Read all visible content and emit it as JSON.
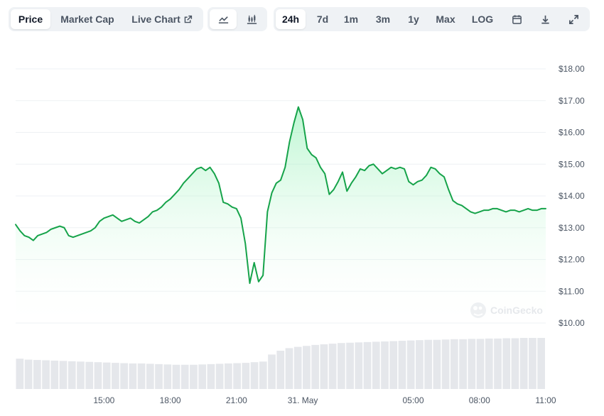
{
  "toolbar": {
    "view_tabs": [
      {
        "label": "Price",
        "active": true
      },
      {
        "label": "Market Cap",
        "active": false
      },
      {
        "label": "Live Chart",
        "active": false,
        "icon": "external-link-icon"
      }
    ],
    "chart_style_buttons": [
      {
        "icon": "line-chart-icon",
        "active": true
      },
      {
        "icon": "candlestick-chart-icon",
        "active": false
      }
    ],
    "range_tabs": [
      {
        "label": "24h",
        "active": true
      },
      {
        "label": "7d",
        "active": false
      },
      {
        "label": "1m",
        "active": false
      },
      {
        "label": "3m",
        "active": false
      },
      {
        "label": "1y",
        "active": false
      },
      {
        "label": "Max",
        "active": false
      },
      {
        "label": "LOG",
        "active": false
      }
    ],
    "utility_buttons": [
      {
        "icon": "calendar-icon"
      },
      {
        "icon": "download-icon"
      },
      {
        "icon": "expand-icon"
      }
    ]
  },
  "watermark": {
    "text": "CoinGecko",
    "icon": "coingecko-logo-icon"
  },
  "colors": {
    "line": "#16a34a",
    "area_top": "#86efac",
    "area_bottom": "#ffffff",
    "volume": "#e5e7eb",
    "grid": "#eef1f4",
    "axis_text": "#4b5563",
    "active_bg": "#ffffff",
    "toolbar_bg": "#eff2f5"
  },
  "chart_data": {
    "type": "area",
    "x_tick_labels": [
      "15:00",
      "18:00",
      "21:00",
      "31. May",
      "05:00",
      "08:00",
      "11:00"
    ],
    "y_tick_labels": [
      "$18.00",
      "$17.00",
      "$16.00",
      "$15.00",
      "$14.00",
      "$13.00",
      "$12.00",
      "$11.00",
      "$10.00"
    ],
    "y_ticks": [
      18,
      17,
      16,
      15,
      14,
      13,
      12,
      11,
      10
    ],
    "x_ticks_hours": [
      15,
      18,
      21,
      24,
      29,
      32,
      35
    ],
    "ylim": [
      10,
      18
    ],
    "xlim_hours": [
      11.0,
      35.0
    ],
    "grid": true,
    "legend": "none",
    "price_series": {
      "name": "",
      "x_hours": [
        11.0,
        11.2,
        11.4,
        11.6,
        11.8,
        12.0,
        12.2,
        12.4,
        12.6,
        12.8,
        13.0,
        13.2,
        13.4,
        13.6,
        13.8,
        14.0,
        14.2,
        14.4,
        14.6,
        14.8,
        15.0,
        15.2,
        15.4,
        15.6,
        15.8,
        16.0,
        16.2,
        16.4,
        16.6,
        16.8,
        17.0,
        17.2,
        17.4,
        17.6,
        17.8,
        18.0,
        18.2,
        18.4,
        18.6,
        18.8,
        19.0,
        19.2,
        19.4,
        19.6,
        19.8,
        20.0,
        20.2,
        20.4,
        20.6,
        20.8,
        21.0,
        21.2,
        21.4,
        21.6,
        21.8,
        22.0,
        22.2,
        22.4,
        22.6,
        22.8,
        23.0,
        23.2,
        23.4,
        23.6,
        23.8,
        24.0,
        24.2,
        24.4,
        24.6,
        24.8,
        25.0,
        25.2,
        25.4,
        25.6,
        25.8,
        26.0,
        26.2,
        26.4,
        26.6,
        26.8,
        27.0,
        27.2,
        27.4,
        27.6,
        27.8,
        28.0,
        28.2,
        28.4,
        28.6,
        28.8,
        29.0,
        29.2,
        29.4,
        29.6,
        29.8,
        30.0,
        30.2,
        30.4,
        30.6,
        30.8,
        31.0,
        31.2,
        31.4,
        31.6,
        31.8,
        32.0,
        32.2,
        32.4,
        32.6,
        32.8,
        33.0,
        33.2,
        33.4,
        33.6,
        33.8,
        34.0,
        34.2,
        34.4,
        34.6,
        34.8,
        35.0
      ],
      "values": [
        13.1,
        12.9,
        12.75,
        12.7,
        12.6,
        12.75,
        12.8,
        12.85,
        12.95,
        13.0,
        13.05,
        13.0,
        12.75,
        12.7,
        12.75,
        12.8,
        12.85,
        12.9,
        13.0,
        13.2,
        13.3,
        13.35,
        13.4,
        13.3,
        13.2,
        13.25,
        13.3,
        13.2,
        13.15,
        13.25,
        13.35,
        13.5,
        13.55,
        13.65,
        13.8,
        13.9,
        14.05,
        14.2,
        14.4,
        14.55,
        14.7,
        14.85,
        14.9,
        14.8,
        14.9,
        14.7,
        14.4,
        13.8,
        13.75,
        13.65,
        13.6,
        13.3,
        12.5,
        11.25,
        11.9,
        11.3,
        11.5,
        13.5,
        14.1,
        14.4,
        14.5,
        14.9,
        15.7,
        16.3,
        16.8,
        16.4,
        15.5,
        15.3,
        15.2,
        14.9,
        14.7,
        14.05,
        14.2,
        14.45,
        14.75,
        14.15,
        14.4,
        14.6,
        14.85,
        14.8,
        14.95,
        15.0,
        14.85,
        14.7,
        14.8,
        14.9,
        14.85,
        14.9,
        14.85,
        14.45,
        14.35,
        14.45,
        14.5,
        14.65,
        14.9,
        14.85,
        14.7,
        14.6,
        14.2,
        13.85,
        13.75,
        13.7,
        13.6,
        13.5,
        13.45,
        13.5,
        13.55,
        13.55,
        13.6,
        13.6,
        13.55,
        13.5,
        13.55,
        13.55,
        13.5,
        13.55,
        13.6,
        13.55,
        13.55,
        13.6,
        13.6
      ]
    },
    "volume_series": {
      "name": "",
      "x_hours": [
        11.0,
        11.4,
        11.8,
        12.2,
        12.6,
        13.0,
        13.4,
        13.8,
        14.2,
        14.6,
        15.0,
        15.4,
        15.8,
        16.2,
        16.6,
        17.0,
        17.4,
        17.8,
        18.2,
        18.6,
        19.0,
        19.4,
        19.8,
        20.2,
        20.6,
        21.0,
        21.4,
        21.8,
        22.2,
        22.6,
        23.0,
        23.4,
        23.8,
        24.2,
        24.6,
        25.0,
        25.4,
        25.8,
        26.2,
        26.6,
        27.0,
        27.4,
        27.8,
        28.2,
        28.6,
        29.0,
        29.4,
        29.8,
        30.2,
        30.6,
        31.0,
        31.4,
        31.8,
        32.2,
        32.6,
        33.0,
        33.4,
        33.8,
        34.2,
        34.6,
        35.0
      ],
      "values": [
        0.95,
        0.92,
        0.91,
        0.9,
        0.89,
        0.88,
        0.87,
        0.86,
        0.85,
        0.84,
        0.83,
        0.82,
        0.81,
        0.8,
        0.8,
        0.79,
        0.78,
        0.77,
        0.76,
        0.76,
        0.76,
        0.77,
        0.78,
        0.79,
        0.8,
        0.81,
        0.82,
        0.84,
        0.86,
        1.08,
        1.2,
        1.28,
        1.32,
        1.35,
        1.38,
        1.4,
        1.42,
        1.44,
        1.45,
        1.46,
        1.47,
        1.48,
        1.49,
        1.5,
        1.51,
        1.52,
        1.53,
        1.54,
        1.54,
        1.55,
        1.56,
        1.56,
        1.57,
        1.57,
        1.58,
        1.58,
        1.59,
        1.59,
        1.6,
        1.6,
        1.6
      ]
    }
  }
}
